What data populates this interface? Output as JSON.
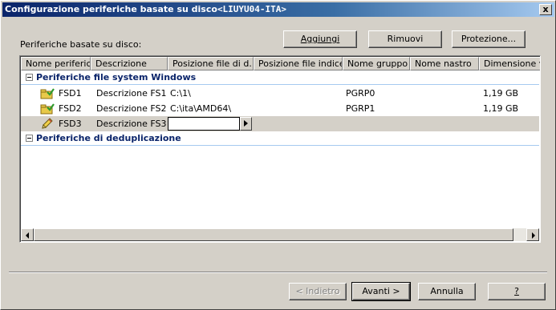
{
  "window": {
    "title_prefix": "Configurazione periferiche basate su disco",
    "title_host": "<LIUYU04-ITA>",
    "close_glyph": "x"
  },
  "list_label": "Periferiche basate su disco:",
  "buttons": {
    "add": "Aggiungi",
    "remove": "Rimuovi",
    "protection": "Protezione...",
    "back": "< Indietro",
    "next": "Avanti >",
    "cancel": "Annulla",
    "help": "?"
  },
  "columns": [
    "Nome periferica",
    "Descrizione",
    "Posizione file di d...",
    "Posizione file indice",
    "Nome gruppo",
    "Nome nastro",
    "Dimensione volume"
  ],
  "groups": [
    {
      "label": "Periferiche file system Windows",
      "rows": [
        {
          "name": "FSD1",
          "description": "Descrizione FS1",
          "data_path": "C:\\1\\",
          "index_path": "",
          "group": "PGRP0",
          "tape": "",
          "size": "1,19 GB",
          "icon": "device-checked-icon"
        },
        {
          "name": "FSD2",
          "description": "Descrizione FS2",
          "data_path": "C:\\ita\\AMD64\\",
          "index_path": "",
          "group": "PGRP1",
          "tape": "",
          "size": "1,19 GB",
          "icon": "device-checked-icon"
        },
        {
          "name": "FSD3",
          "description": "Descrizione FS3",
          "data_path": "",
          "index_path": "",
          "group": "",
          "tape": "",
          "size": "",
          "icon": "pencil-edit-icon"
        }
      ]
    },
    {
      "label": "Periferiche di deduplicazione",
      "rows": []
    }
  ],
  "colors": {
    "title_gradient_start": "#0a246a",
    "title_gradient_end": "#a6caf0",
    "group_text": "#0a246a",
    "face": "#d4d0c8"
  }
}
